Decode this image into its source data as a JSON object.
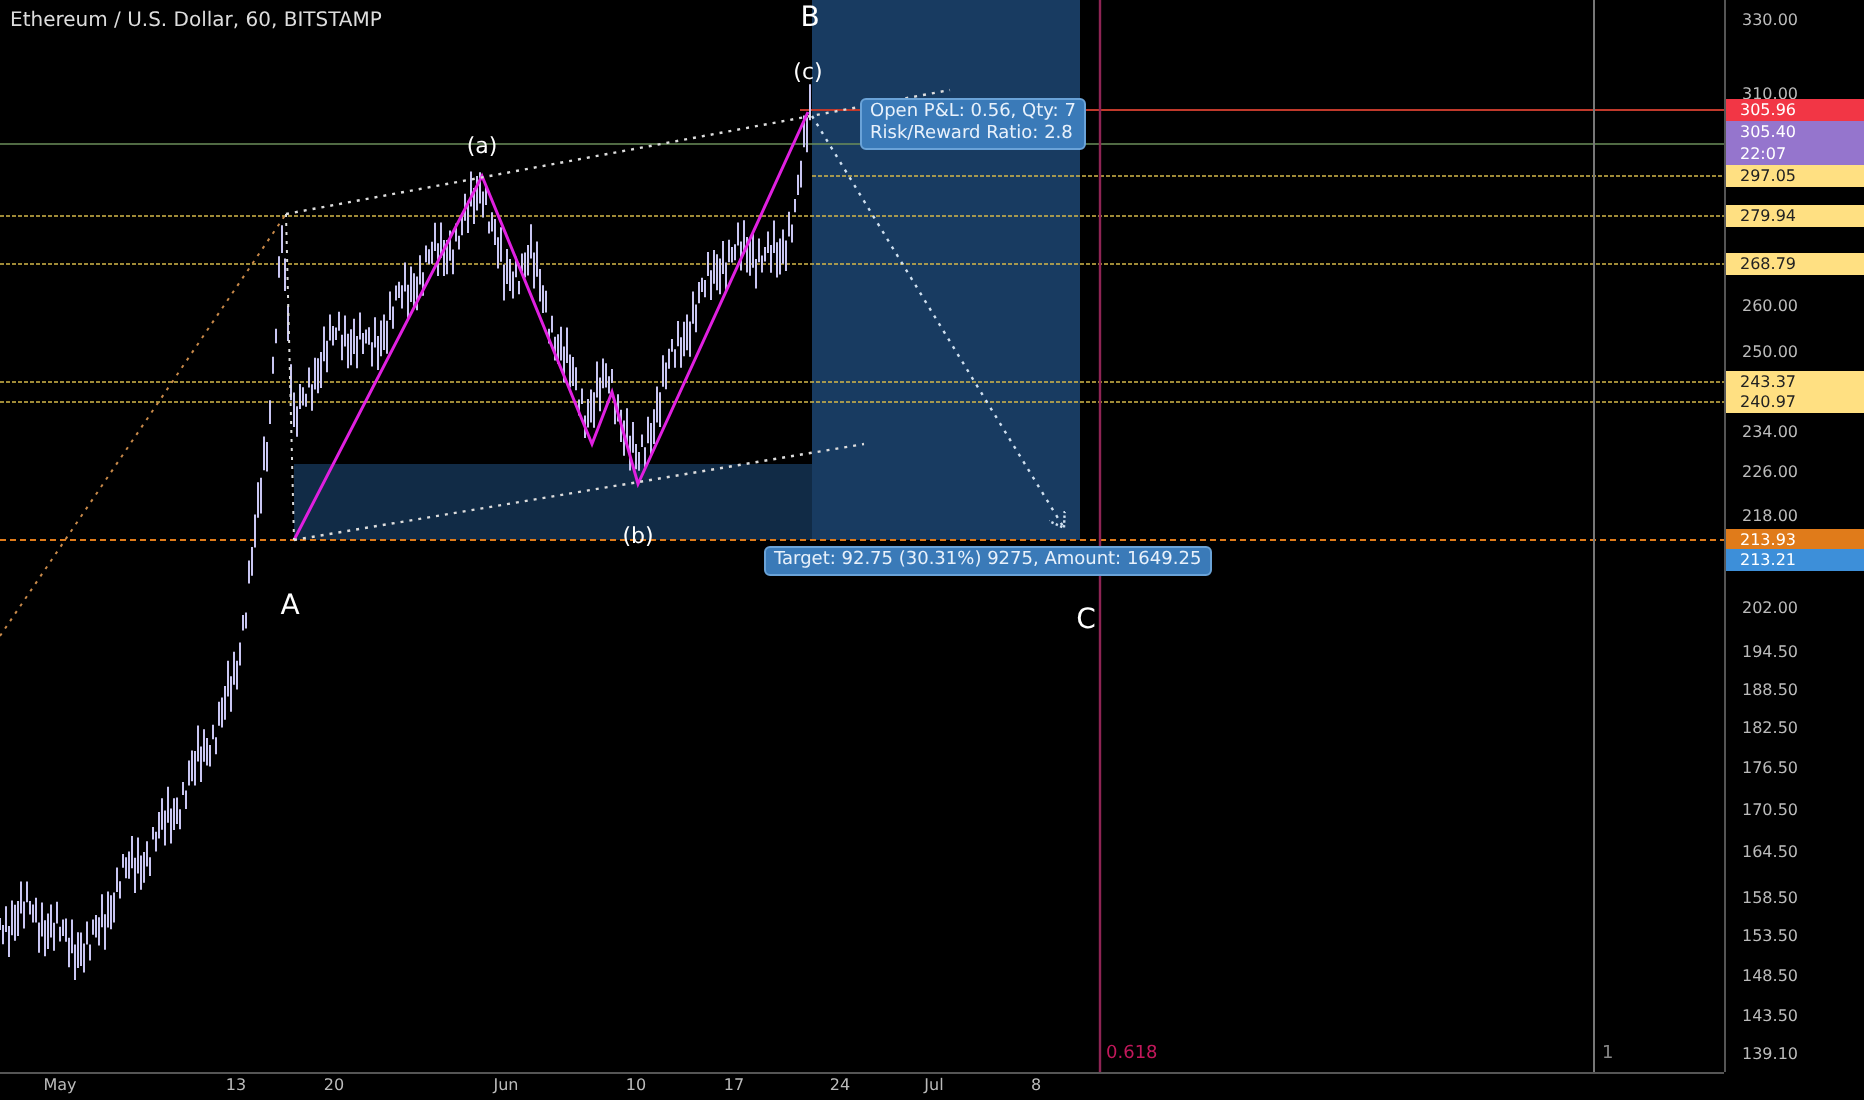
{
  "header": {
    "title": "Ethereum / U.S. Dollar, 60, BITSTAMP"
  },
  "wave_labels": [
    {
      "text": "B"
    },
    {
      "text": "(c)"
    },
    {
      "text": "(a)"
    },
    {
      "text": "(b)"
    },
    {
      "text": "A"
    },
    {
      "text": "C"
    }
  ],
  "position": {
    "pnl": "Open P&L: 0.56, Qty: 7",
    "ratio": "Risk/Reward Ratio: 2.8",
    "target": "Target: 92.75 (30.31%) 9275, Amount: 1649.25"
  },
  "fib_labels": [
    {
      "text": "0.618"
    },
    {
      "text": "1"
    }
  ],
  "price_axis": {
    "ticks": [
      "330.00",
      "310.00",
      "260.00",
      "250.00",
      "234.00",
      "226.00",
      "218.00",
      "202.00",
      "194.50",
      "188.50",
      "182.50",
      "176.50",
      "170.50",
      "164.50",
      "158.50",
      "153.50",
      "148.50",
      "143.50",
      "139.10"
    ],
    "tags": [
      {
        "text": "305.96",
        "color": "#f23645"
      },
      {
        "text": "305.40",
        "color": "#9575cd"
      },
      {
        "text": "22:07",
        "color": "#9575cd"
      },
      {
        "text": "297.05",
        "color": "#ffe082"
      },
      {
        "text": "279.94",
        "color": "#ffe082"
      },
      {
        "text": "268.79",
        "color": "#ffe082"
      },
      {
        "text": "243.37",
        "color": "#ffe082"
      },
      {
        "text": "240.97",
        "color": "#ffe082"
      },
      {
        "text": "213.93",
        "color": "#e07b1a"
      },
      {
        "text": "213.21",
        "color": "#3d8fd9"
      }
    ]
  },
  "time_axis": {
    "ticks": [
      "May",
      "13",
      "20",
      "Jun",
      "10",
      "17",
      "24",
      "Jul",
      "8"
    ]
  }
}
